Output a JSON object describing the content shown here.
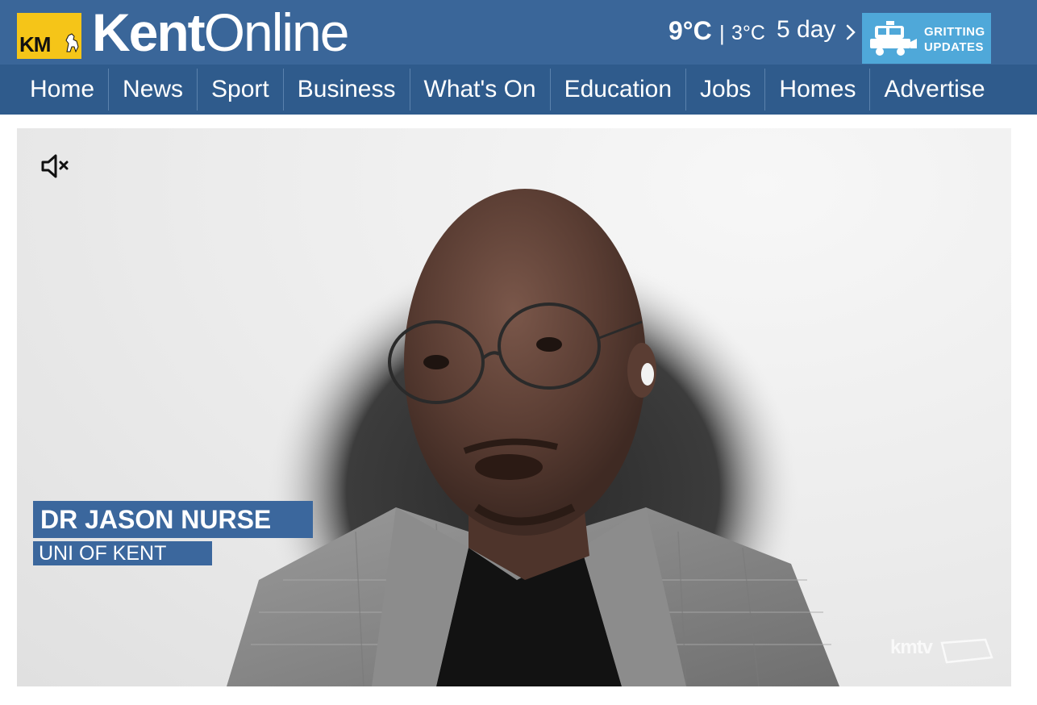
{
  "header": {
    "logo_badge": "KM",
    "brand_part1": "Kent",
    "brand_part2": "Online",
    "weather": {
      "temp_high": "9°C",
      "separator": "|",
      "temp_low": "3°C",
      "forecast_link": "5 day"
    },
    "gritting_line1": "GRITTING",
    "gritting_line2": "UPDATES"
  },
  "nav": {
    "items": [
      "Home",
      "News",
      "Sport",
      "Business",
      "What's On",
      "Education",
      "Jobs",
      "Homes",
      "Advertise"
    ]
  },
  "video": {
    "lower_third_name": "DR JASON NURSE",
    "lower_third_org": "UNI OF KENT",
    "watermark": "kmtv",
    "mute_icon": "volume-muted-icon"
  },
  "colors": {
    "header_bg": "#3a6699",
    "nav_bg": "#2f5b8c",
    "badge_yellow": "#f5c518",
    "gritting_bg": "#4fa8d9",
    "lower_third_bg": "#3b679d"
  }
}
